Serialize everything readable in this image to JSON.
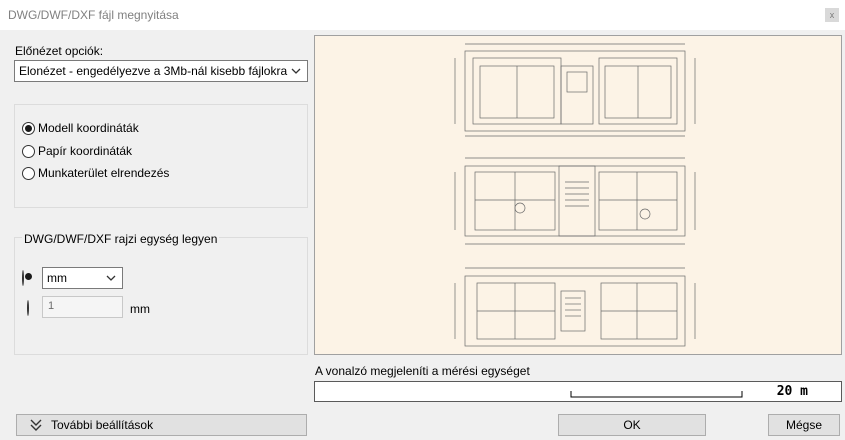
{
  "window": {
    "title": "DWG/DWF/DXF fájl megnyitása",
    "close_glyph": "x"
  },
  "preview_options": {
    "label": "Előnézet opciók:",
    "selected": "Elonézet - engedélyezve a 3Mb-nál kisebb fájlokra"
  },
  "coordinates": {
    "options": [
      {
        "label": "Modell koordináták",
        "selected": true
      },
      {
        "label": "Papír koordináták",
        "selected": false
      },
      {
        "label": "Munkaterület elrendezés",
        "selected": false
      }
    ]
  },
  "units": {
    "title": "DWG/DWF/DXF rajzi egység legyen",
    "unit_selected": "mm",
    "custom_value": "1",
    "custom_unit": "mm",
    "unit_radio_selected": true
  },
  "scale": {
    "label": "A vonalzó megjeleníti a mérési egységet",
    "value": "20 m"
  },
  "buttons": {
    "more_settings": "További beállítások",
    "ok": "OK",
    "cancel": "Mégse"
  },
  "icons": {
    "chevron": "chevron-down-icon",
    "double_chevron": "double-chevron-down-icon"
  },
  "colors": {
    "preview_bg": "#fcf3e6",
    "drawing_line": "#6a6a6a"
  }
}
